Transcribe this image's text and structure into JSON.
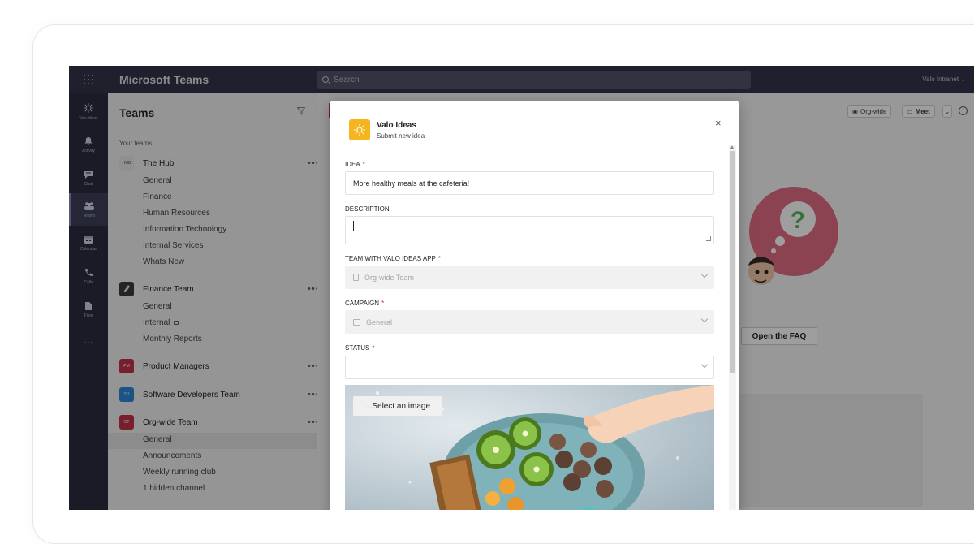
{
  "app": {
    "title": "Microsoft Teams",
    "search_placeholder": "Search",
    "tenant": "Valo Intranet"
  },
  "rail": {
    "items": [
      {
        "label": "Valo Ideas",
        "icon": "lightbulb-icon"
      },
      {
        "label": "Activity",
        "icon": "bell-icon"
      },
      {
        "label": "Chat",
        "icon": "chat-icon"
      },
      {
        "label": "Teams",
        "icon": "teams-icon"
      },
      {
        "label": "Calendar",
        "icon": "calendar-icon"
      },
      {
        "label": "Calls",
        "icon": "phone-icon"
      },
      {
        "label": "Files",
        "icon": "file-icon"
      },
      {
        "label": "...",
        "icon": "more-icon"
      }
    ]
  },
  "teams_panel": {
    "title": "Teams",
    "section_label": "Your teams",
    "teams": [
      {
        "name": "The Hub",
        "tile_text": "HUB",
        "tile_color": "#e9e9e9",
        "channels": [
          "General",
          "Finance",
          "Human Resources",
          "Information Technology",
          "Internal Services",
          "Whats New"
        ]
      },
      {
        "name": "Finance Team",
        "tile_text": "",
        "tile_color": "#3b3a39",
        "channels": [
          "General",
          "Internal",
          "Monthly Reports"
        ]
      },
      {
        "name": "Product Managers",
        "tile_text": "PM",
        "tile_color": "#c4314b",
        "channels": []
      },
      {
        "name": "Software Developers Team",
        "tile_text": "SD",
        "tile_color": "#2b88d8",
        "channels": []
      },
      {
        "name": "Org-wide Team",
        "tile_text": "OT",
        "tile_color": "#c4314b",
        "channels": [
          "General",
          "Announcements",
          "Weekly running club",
          "1 hidden channel"
        ]
      }
    ],
    "more_label": "•••"
  },
  "main": {
    "org_wide_label": "Org-wide",
    "meet_label": "Meet",
    "faq_button": "Open the FAQ"
  },
  "dialog": {
    "app_name": "Valo Ideas",
    "subtitle": "Submit new idea",
    "close_glyph": "×",
    "fields": {
      "idea": {
        "label": "IDEA",
        "value": "More healthy meals at the cafeteria!",
        "required": true
      },
      "description": {
        "label": "DESCRIPTION",
        "value": "",
        "required": false
      },
      "team": {
        "label": "TEAM WITH VALO IDEAS APP",
        "value": "Org-wide Team",
        "required": true
      },
      "campaign": {
        "label": "CAMPAIGN",
        "value": "General",
        "required": true
      },
      "status": {
        "label": "STATUS",
        "value": "",
        "required": true
      }
    },
    "required_marker": "*",
    "select_image_label": "...Select an image"
  },
  "colors": {
    "topbar": "#33344a",
    "rail": "#2c2d42",
    "brand_yellow": "#f6b51f",
    "required_red": "#c4314b"
  }
}
